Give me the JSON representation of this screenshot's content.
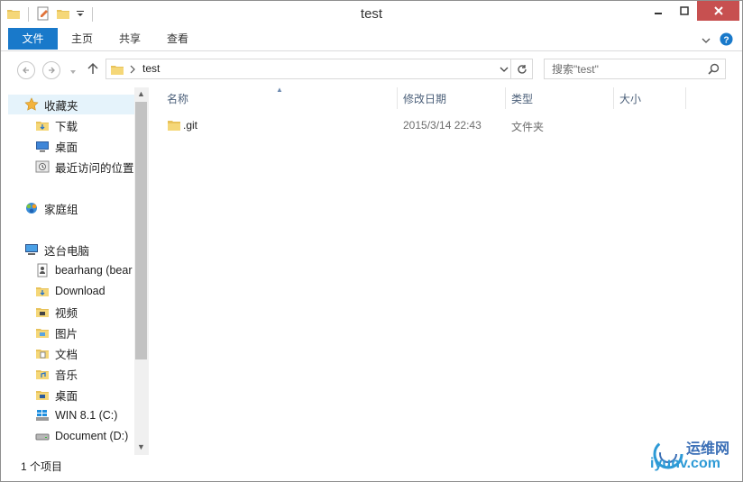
{
  "window": {
    "title": "test"
  },
  "ribbon": {
    "tabs": [
      {
        "label": "文件",
        "active": true
      },
      {
        "label": "主页"
      },
      {
        "label": "共享"
      },
      {
        "label": "查看"
      }
    ]
  },
  "address": {
    "path": [
      "test"
    ]
  },
  "search": {
    "placeholder": "搜索\"test\""
  },
  "navigation": {
    "favorites": {
      "label": "收藏夹",
      "items": [
        "下载",
        "桌面",
        "最近访问的位置"
      ]
    },
    "homegroup": {
      "label": "家庭组"
    },
    "this_pc": {
      "label": "这台电脑",
      "items": [
        "bearhang (bear",
        "Download",
        "视频",
        "图片",
        "文档",
        "音乐",
        "桌面",
        "WIN 8.1 (C:)",
        "Document (D:)"
      ]
    }
  },
  "columns": [
    "名称",
    "修改日期",
    "类型",
    "大小"
  ],
  "files": [
    {
      "name": ".git",
      "modified": "2015/3/14 22:43",
      "type": "文件夹",
      "size": ""
    }
  ],
  "status": {
    "item_count": "1 个项目"
  },
  "watermark": {
    "cn": "运维网",
    "en": "iyunv.com"
  },
  "colors": {
    "accent": "#1979ca",
    "close": "#c75050",
    "selected": "#e5f3fb",
    "header_text": "#4c607a"
  }
}
